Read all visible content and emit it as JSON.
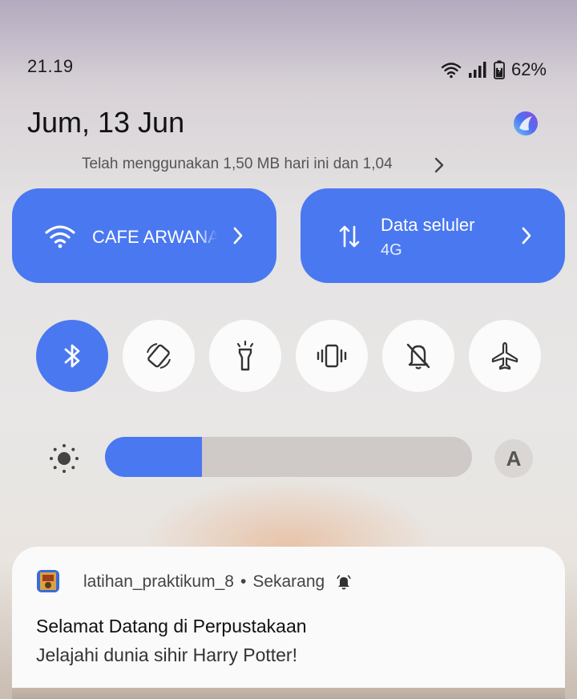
{
  "status_bar": {
    "time": "21.19",
    "battery_percent": "62%",
    "battery_level": 0.62,
    "icons": [
      "wifi-icon",
      "signal-icon",
      "battery-icon"
    ]
  },
  "header": {
    "date": "Jum, 13 Jun",
    "profile_icon": "assistant-icon"
  },
  "usage": {
    "text": "Telah menggunakan 1,50 MB hari ini dan 1,04"
  },
  "tiles": {
    "wifi": {
      "label": "CAFE ARWANA",
      "icon": "wifi-icon",
      "active": true
    },
    "data": {
      "label": "Data seluler",
      "sub": "4G",
      "icon": "data-transfer-icon",
      "active": true
    }
  },
  "toggles": [
    {
      "name": "bluetooth",
      "icon": "bluetooth-icon",
      "active": true
    },
    {
      "name": "auto-rotate",
      "icon": "rotate-icon",
      "active": false
    },
    {
      "name": "flashlight",
      "icon": "flashlight-icon",
      "active": false
    },
    {
      "name": "vibrate",
      "icon": "vibrate-icon",
      "active": false
    },
    {
      "name": "silent",
      "icon": "bell-off-icon",
      "active": false
    },
    {
      "name": "airplane",
      "icon": "airplane-icon",
      "active": false
    }
  ],
  "brightness": {
    "level": 0.265,
    "auto_label": "A"
  },
  "notification": {
    "app_name": "latihan_praktikum_8",
    "separator": "•",
    "time": "Sekarang",
    "title": "Selamat Datang di Perpustakaan",
    "body": "Jelajahi dunia sihir Harry Potter!"
  },
  "colors": {
    "accent": "#4a78f0",
    "tile_text": "#ffffff",
    "inactive_button": "#fbfbfb"
  }
}
